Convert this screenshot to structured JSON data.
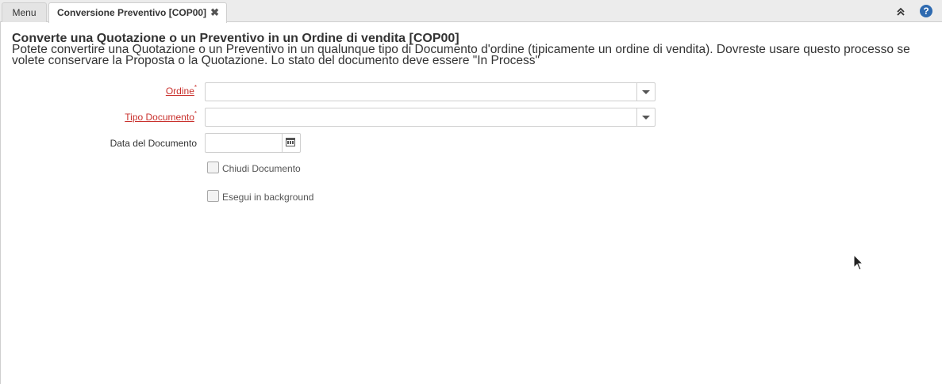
{
  "tabs": {
    "menu_label": "Menu",
    "active_label": "Conversione Preventivo [COP00]",
    "close_glyph": "✖"
  },
  "toolbar": {
    "help_glyph": "?"
  },
  "process": {
    "title": "Converte una Quotazione o un Preventivo in un Ordine di vendita [COP00]",
    "description": "Potete convertire una Quotazione o un Preventivo in un qualunque tipo di Documento d'ordine (tipicamente un ordine di vendita). Dovreste usare questo processo se volete conservare la Proposta o la Quotazione. Lo stato del documento deve essere \"In Process\""
  },
  "form": {
    "ordine_label": "Ordine",
    "ordine_value": "",
    "tipo_documento_label": "Tipo Documento",
    "tipo_documento_value": "",
    "required_mark": "*",
    "data_documento_label": "Data del Documento",
    "data_documento_value": "",
    "chiudi_documento_label": "Chiudi Documento",
    "chiudi_documento_checked": false,
    "esegui_background_label": "Esegui in background",
    "esegui_background_checked": false
  },
  "colors": {
    "required": "#c9302c",
    "help_icon": "#2e6ab0"
  }
}
